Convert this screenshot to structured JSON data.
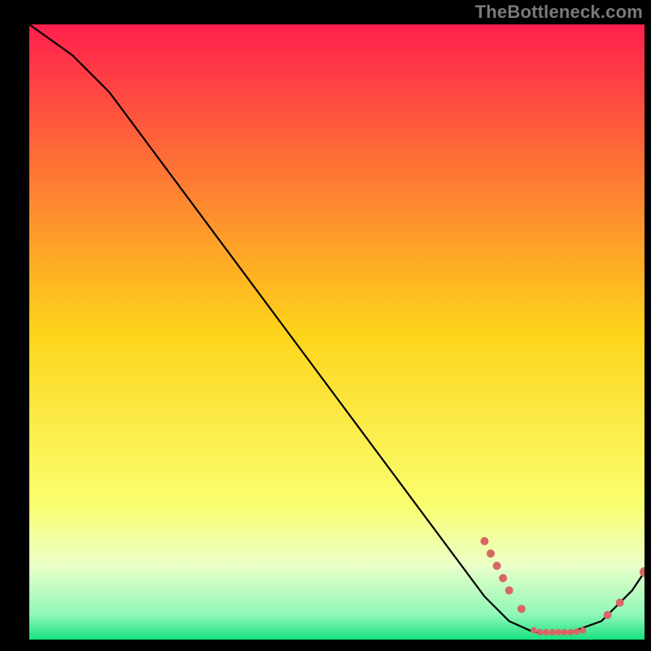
{
  "watermark": "TheBottleneck.com",
  "chart_data": {
    "type": "line",
    "title": "",
    "xlabel": "",
    "ylabel": "",
    "xlim": [
      0,
      100
    ],
    "ylim": [
      0,
      100
    ],
    "background": {
      "type": "vertical-gradient",
      "stops": [
        {
          "offset": 0.0,
          "color": "#ff1f4d"
        },
        {
          "offset": 0.5,
          "color": "#fdd41a"
        },
        {
          "offset": 0.78,
          "color": "#faff6f"
        },
        {
          "offset": 0.88,
          "color": "#eaffc8"
        },
        {
          "offset": 0.96,
          "color": "#8ef7b8"
        },
        {
          "offset": 1.0,
          "color": "#16e27e"
        }
      ]
    },
    "series": [
      {
        "name": "bottleneck-curve",
        "color": "#000000",
        "points": [
          {
            "x": 0,
            "y": 100
          },
          {
            "x": 7,
            "y": 95
          },
          {
            "x": 13,
            "y": 89
          },
          {
            "x": 74,
            "y": 7
          },
          {
            "x": 78,
            "y": 3
          },
          {
            "x": 82,
            "y": 1.2
          },
          {
            "x": 88,
            "y": 1.2
          },
          {
            "x": 93,
            "y": 3
          },
          {
            "x": 98,
            "y": 8
          },
          {
            "x": 100,
            "y": 11
          }
        ]
      }
    ],
    "markers": [
      {
        "x": 74,
        "y": 16,
        "color": "#d86666",
        "r": 5
      },
      {
        "x": 75,
        "y": 14,
        "color": "#d86666",
        "r": 5
      },
      {
        "x": 76,
        "y": 12,
        "color": "#d86666",
        "r": 5
      },
      {
        "x": 77,
        "y": 10,
        "color": "#d86666",
        "r": 5
      },
      {
        "x": 78,
        "y": 8,
        "color": "#d86666",
        "r": 5
      },
      {
        "x": 80,
        "y": 5,
        "color": "#d86666",
        "r": 5
      },
      {
        "x": 82,
        "y": 1.5,
        "color": "#d86666",
        "r": 4
      },
      {
        "x": 83,
        "y": 1.2,
        "color": "#d86666",
        "r": 4
      },
      {
        "x": 84,
        "y": 1.2,
        "color": "#d86666",
        "r": 4
      },
      {
        "x": 85,
        "y": 1.2,
        "color": "#d86666",
        "r": 4
      },
      {
        "x": 86,
        "y": 1.2,
        "color": "#d86666",
        "r": 4
      },
      {
        "x": 87,
        "y": 1.2,
        "color": "#d86666",
        "r": 4
      },
      {
        "x": 88,
        "y": 1.2,
        "color": "#d86666",
        "r": 4
      },
      {
        "x": 89,
        "y": 1.3,
        "color": "#d86666",
        "r": 4
      },
      {
        "x": 90,
        "y": 1.5,
        "color": "#d86666",
        "r": 4
      },
      {
        "x": 94,
        "y": 4,
        "color": "#d86666",
        "r": 5
      },
      {
        "x": 96,
        "y": 6,
        "color": "#d86666",
        "r": 5
      },
      {
        "x": 100,
        "y": 11,
        "color": "#d86666",
        "r": 6
      }
    ]
  }
}
